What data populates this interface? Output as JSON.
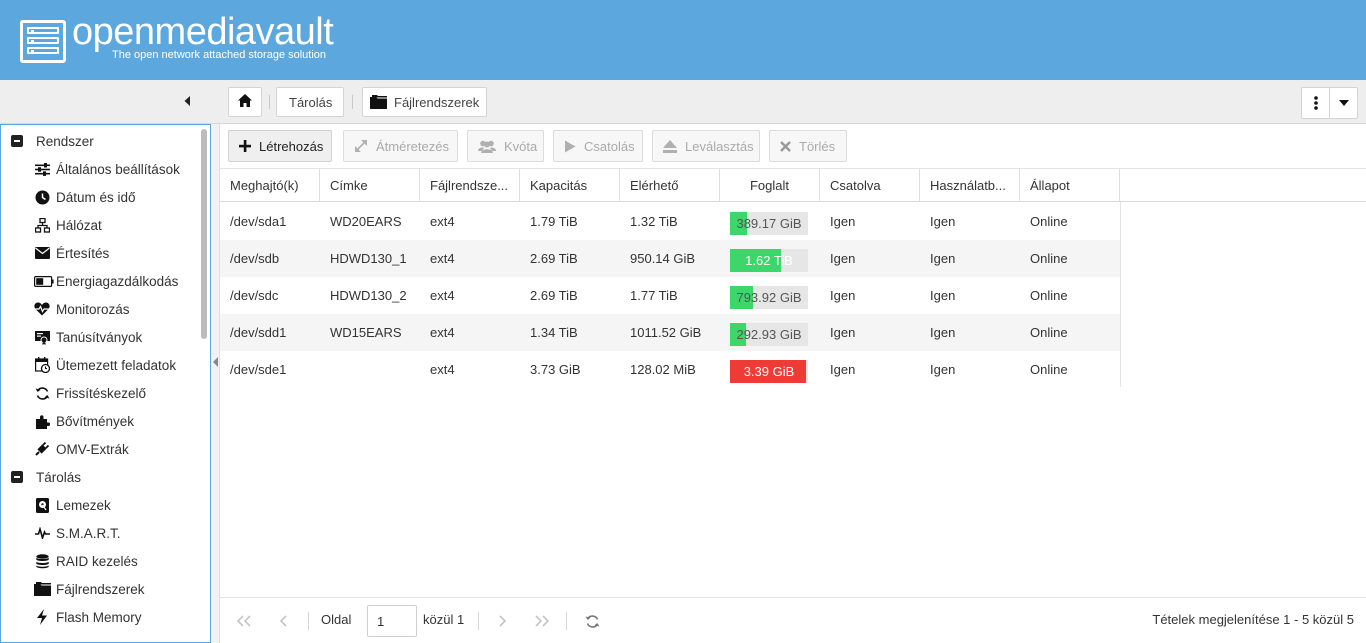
{
  "app": {
    "title": "openmediavault",
    "subtitle": "The open network attached storage solution"
  },
  "breadcrumb": {
    "storage": "Tárolás",
    "filesystems": "Fájlrendszerek"
  },
  "sidebar": {
    "sections": [
      {
        "label": "Rendszer"
      },
      {
        "label": "Tárolás"
      }
    ],
    "items": [
      {
        "label": "Általános beállítások",
        "icon": "sliders-icon"
      },
      {
        "label": "Dátum és idő",
        "icon": "clock-icon"
      },
      {
        "label": "Hálózat",
        "icon": "network-icon"
      },
      {
        "label": "Értesítés",
        "icon": "envelope-icon"
      },
      {
        "label": "Energiagazdálkodás",
        "icon": "battery-icon"
      },
      {
        "label": "Monitorozás",
        "icon": "heartbeat-icon"
      },
      {
        "label": "Tanúsítványok",
        "icon": "certificate-icon"
      },
      {
        "label": "Ütemezett feladatok",
        "icon": "calendar-clock-icon"
      },
      {
        "label": "Frissítéskezelő",
        "icon": "refresh-icon"
      },
      {
        "label": "Bővítmények",
        "icon": "puzzle-icon"
      },
      {
        "label": "OMV-Extrák",
        "icon": "plug-icon"
      },
      {
        "label": "Lemezek",
        "icon": "disk-icon"
      },
      {
        "label": "S.M.A.R.T.",
        "icon": "pulse-icon"
      },
      {
        "label": "RAID kezelés",
        "icon": "database-icon"
      },
      {
        "label": "Fájlrendszerek",
        "icon": "folder-icon"
      },
      {
        "label": "Flash Memory",
        "icon": "bolt-icon"
      }
    ]
  },
  "toolbar": {
    "create": "Létrehozás",
    "resize": "Átméretezés",
    "quota": "Kvóta",
    "mount": "Csatolás",
    "unmount": "Leválasztás",
    "delete": "Törlés"
  },
  "grid": {
    "columns": [
      "Meghajtó(k)",
      "Címke",
      "Fájlrendsze...",
      "Kapacitás",
      "Elérhető",
      "Foglalt",
      "Csatolva",
      "Használatb...",
      "Állapot"
    ],
    "rows": [
      {
        "device": "/dev/sda1",
        "label": "WD20EARS",
        "fs": "ext4",
        "capacity": "1.79 TiB",
        "available": "1.32 TiB",
        "used": "389.17 GiB",
        "used_fraction": 0.22,
        "used_color": "#3dd66a",
        "mounted": "Igen",
        "referenced": "Igen",
        "status": "Online"
      },
      {
        "device": "/dev/sdb",
        "label": "HDWD130_1",
        "fs": "ext4",
        "capacity": "2.69 TiB",
        "available": "950.14 GiB",
        "used": "1.62 TiB",
        "used_fraction": 0.66,
        "used_color": "#3dd66a",
        "mounted": "Igen",
        "referenced": "Igen",
        "status": "Online"
      },
      {
        "device": "/dev/sdc",
        "label": "HDWD130_2",
        "fs": "ext4",
        "capacity": "2.69 TiB",
        "available": "1.77 TiB",
        "used": "793.92 GiB",
        "used_fraction": 0.29,
        "used_color": "#3dd66a",
        "mounted": "Igen",
        "referenced": "Igen",
        "status": "Online"
      },
      {
        "device": "/dev/sdd1",
        "label": "WD15EARS",
        "fs": "ext4",
        "capacity": "1.34 TiB",
        "available": "1011.52 GiB",
        "used": "292.93 GiB",
        "used_fraction": 0.21,
        "used_color": "#3dd66a",
        "mounted": "Igen",
        "referenced": "Igen",
        "status": "Online"
      },
      {
        "device": "/dev/sde1",
        "label": "",
        "fs": "ext4",
        "capacity": "3.73 GiB",
        "available": "128.02 MiB",
        "used": "3.39 GiB",
        "used_fraction": 0.97,
        "used_color": "#ef3b36",
        "mounted": "Igen",
        "referenced": "Igen",
        "status": "Online"
      }
    ]
  },
  "pager": {
    "page_label": "Oldal",
    "page_value": "1",
    "of_label": "közül 1",
    "summary": "Tételek megjelenítése 1 - 5 közül 5"
  }
}
